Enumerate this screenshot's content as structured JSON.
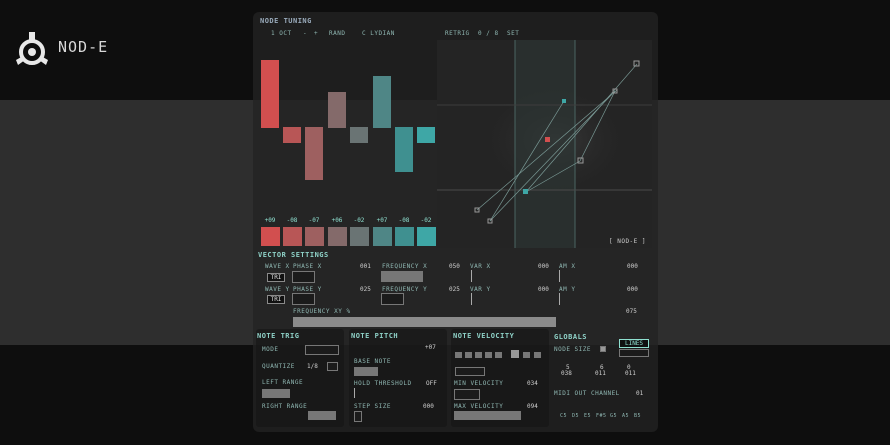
{
  "brand": {
    "name": "NOD-E"
  },
  "header": {
    "title": "NODE TUNING",
    "octave": "1 OCT",
    "minus": "-",
    "plus": "+",
    "rand": "RAND",
    "scale": "C LYDIAN",
    "retrig_label": "RETRIG",
    "retrig_value": "0 / 8",
    "set": "SET"
  },
  "steps": {
    "labels": [
      "+09",
      "-08",
      "-07",
      "+06",
      "-02",
      "+07",
      "-08",
      "-02"
    ],
    "colors": [
      "#d24f4f",
      "#b85656",
      "#9e6060",
      "#846a6a",
      "#6a7474",
      "#4f8686",
      "#3f9090",
      "#3ea7a6"
    ]
  },
  "xy": {
    "tag": "[ NOD-E ]"
  },
  "vector": {
    "title": "VECTOR SETTINGS",
    "wave_x": "WAVE X",
    "phase_x": "PHASE X",
    "wave_x_btn": "TRI",
    "value_001": "001",
    "freq_x": "FREQUENCY X",
    "freq_x_val": "050",
    "var_x": "VAR X",
    "var_x_val": "000",
    "am_x": "AM X",
    "am_x_val": "000",
    "wave_y": "WAVE Y",
    "phase_y": "PHASE Y",
    "wave_y_btn": "TRI",
    "value_025": "025",
    "freq_y": "FREQUENCY Y",
    "freq_y_val": "025",
    "var_y": "VAR Y",
    "var_y_val": "000",
    "am_y": "AM Y",
    "am_y_val": "000",
    "freq_xy": "FREQUENCY XY %",
    "freq_xy_val": "075"
  },
  "note_trig": {
    "title": "NOTE TRIG",
    "mode": "MODE",
    "quantize": "QUANTIZE",
    "quantize_val": "1/8",
    "left_range": "LEFT RANGE",
    "right_range": "RIGHT RANGE"
  },
  "note_pitch": {
    "title": "NOTE PITCH",
    "pitch_val": "+07",
    "base_note": "BASE NOTE",
    "hold_threshold": "HOLD THRESHOLD",
    "hold_val": "OFF",
    "step_size": "STEP SIZE",
    "step_val": "000"
  },
  "note_velocity": {
    "title": "NOTE VELOCITY",
    "min_velocity": "MIN VELOCITY",
    "min_val": "034",
    "max_velocity": "MAX VELOCITY",
    "max_val": "094"
  },
  "globals": {
    "title": "GLOBALS",
    "lines_btn": "LINES",
    "node_size": "NODE SIZE",
    "nums": [
      "5",
      "6",
      "0"
    ],
    "vals": [
      "038",
      "011",
      "011"
    ],
    "midi_out": "MIDI OUT CHANNEL",
    "midi_out_val": "01",
    "note_labels": [
      "C5",
      "D5",
      "E5",
      "F#5",
      "G5",
      "A5",
      "B5"
    ]
  }
}
